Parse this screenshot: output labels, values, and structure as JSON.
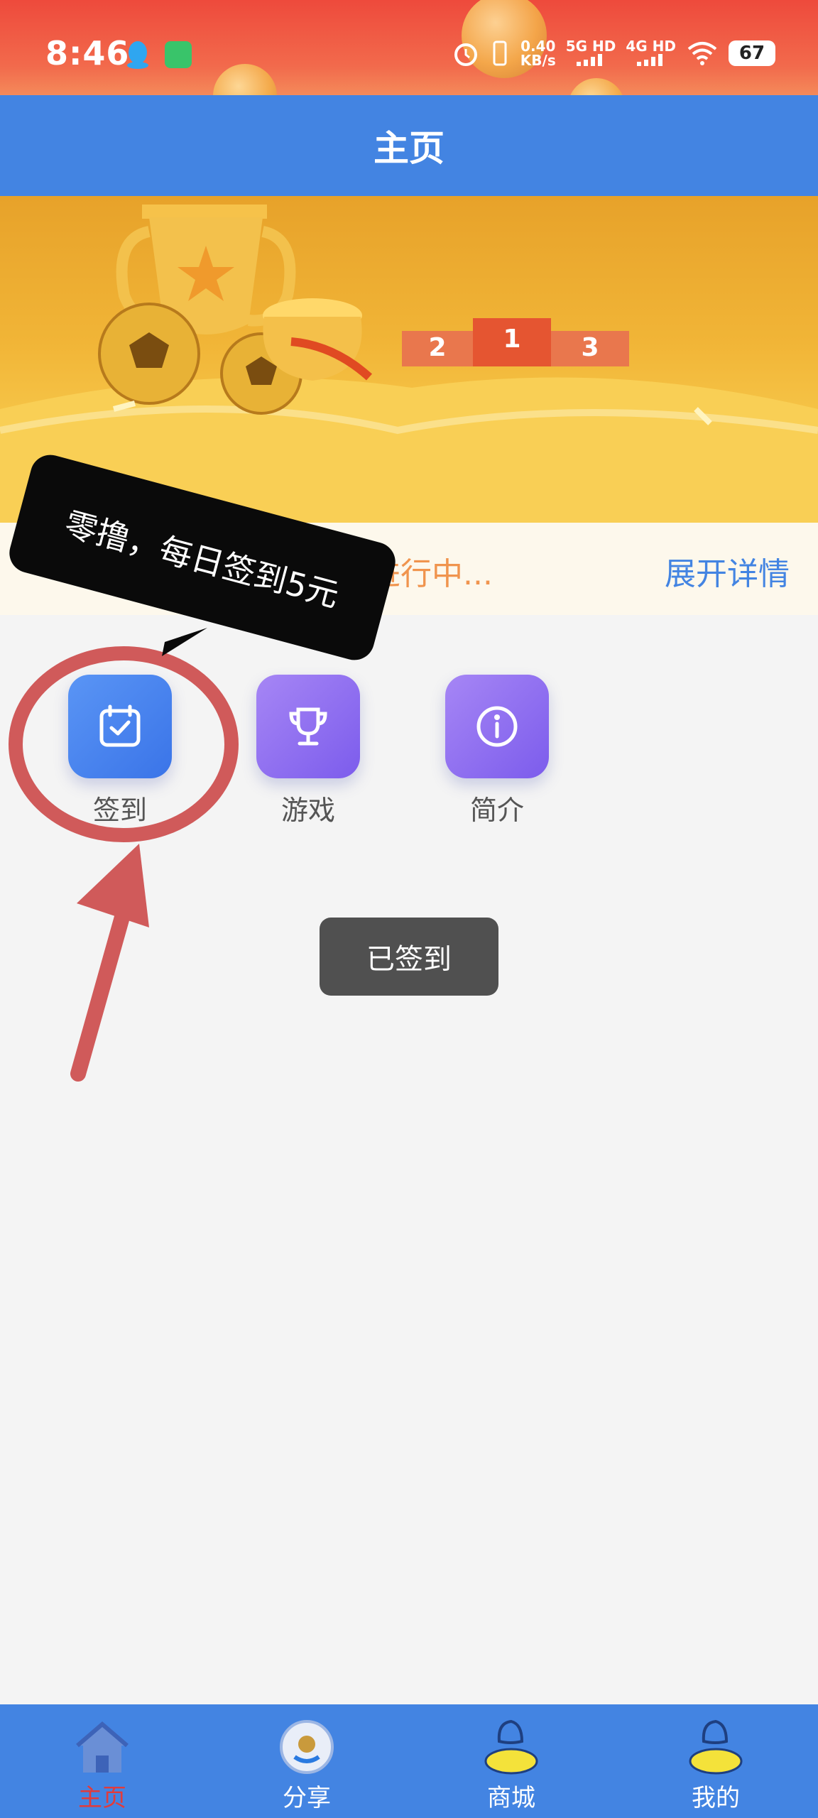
{
  "status_bar": {
    "time": "8:46",
    "speed_top": "0.40",
    "speed_bottom": "KB/s",
    "net1": "5G HD",
    "net2": "4G HD",
    "battery": "67"
  },
  "header": {
    "title": "主页"
  },
  "banner": {
    "ranks": [
      "2",
      "1",
      "3"
    ]
  },
  "notice": {
    "text": "进行中...",
    "link": "展开详情"
  },
  "features": [
    {
      "label": "签到",
      "icon": "calendar-check-icon"
    },
    {
      "label": "游戏",
      "icon": "trophy-icon"
    },
    {
      "label": "简介",
      "icon": "info-icon"
    }
  ],
  "toast": {
    "text": "已签到"
  },
  "annotation": {
    "callout": "零撸，每日签到5元"
  },
  "bottom_nav": [
    {
      "label": "主页",
      "icon": "home-icon",
      "active": true
    },
    {
      "label": "分享",
      "icon": "share-badge-icon"
    },
    {
      "label": "商城",
      "icon": "shop-icon"
    },
    {
      "label": "我的",
      "icon": "profile-icon"
    }
  ],
  "colors": {
    "primary": "#4384e2",
    "active_nav": "#e23b3b",
    "notice_text": "#f0944e",
    "annotation_red": "#d05a5a"
  }
}
